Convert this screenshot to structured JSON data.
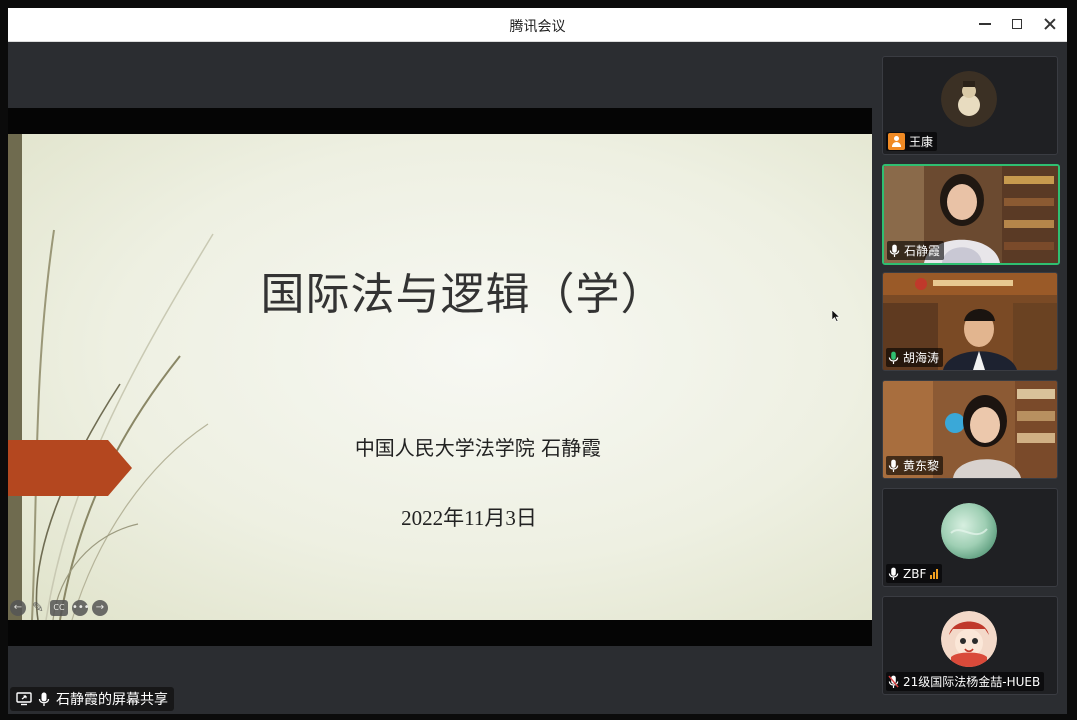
{
  "window": {
    "title": "腾讯会议"
  },
  "slide": {
    "title": "国际法与逻辑（学）",
    "subtitle": "中国人民大学法学院  石静霞",
    "date": "2022年11月3日",
    "accent_color": "#b4471f",
    "bar_color": "#6f6b4f"
  },
  "slide_nav": [
    "arrow-left-icon",
    "pen-icon",
    "cc-icon",
    "more-icon",
    "arrow-right-icon"
  ],
  "share_label": {
    "text": "石静霞的屏幕共享"
  },
  "participants": [
    {
      "name": "王康",
      "icon": "person-icon",
      "video": false,
      "speaking": false
    },
    {
      "name": "石静霞",
      "icon": "mic-icon",
      "video": true,
      "speaking": true
    },
    {
      "name": "胡海涛",
      "icon": "mic-icon",
      "video": true,
      "speaking": false
    },
    {
      "name": "黄东黎",
      "icon": "mic-icon",
      "video": true,
      "speaking": false
    },
    {
      "name": "ZBF",
      "icon": "mic-icon",
      "video": false,
      "speaking": false,
      "signal": true
    },
    {
      "name": "21级国际法杨金喆-HUEB",
      "icon": "mic-muted-icon",
      "video": false,
      "speaking": false
    }
  ],
  "colors": {
    "active_border": "#2fbf71",
    "host_badge": "#f08a24"
  }
}
